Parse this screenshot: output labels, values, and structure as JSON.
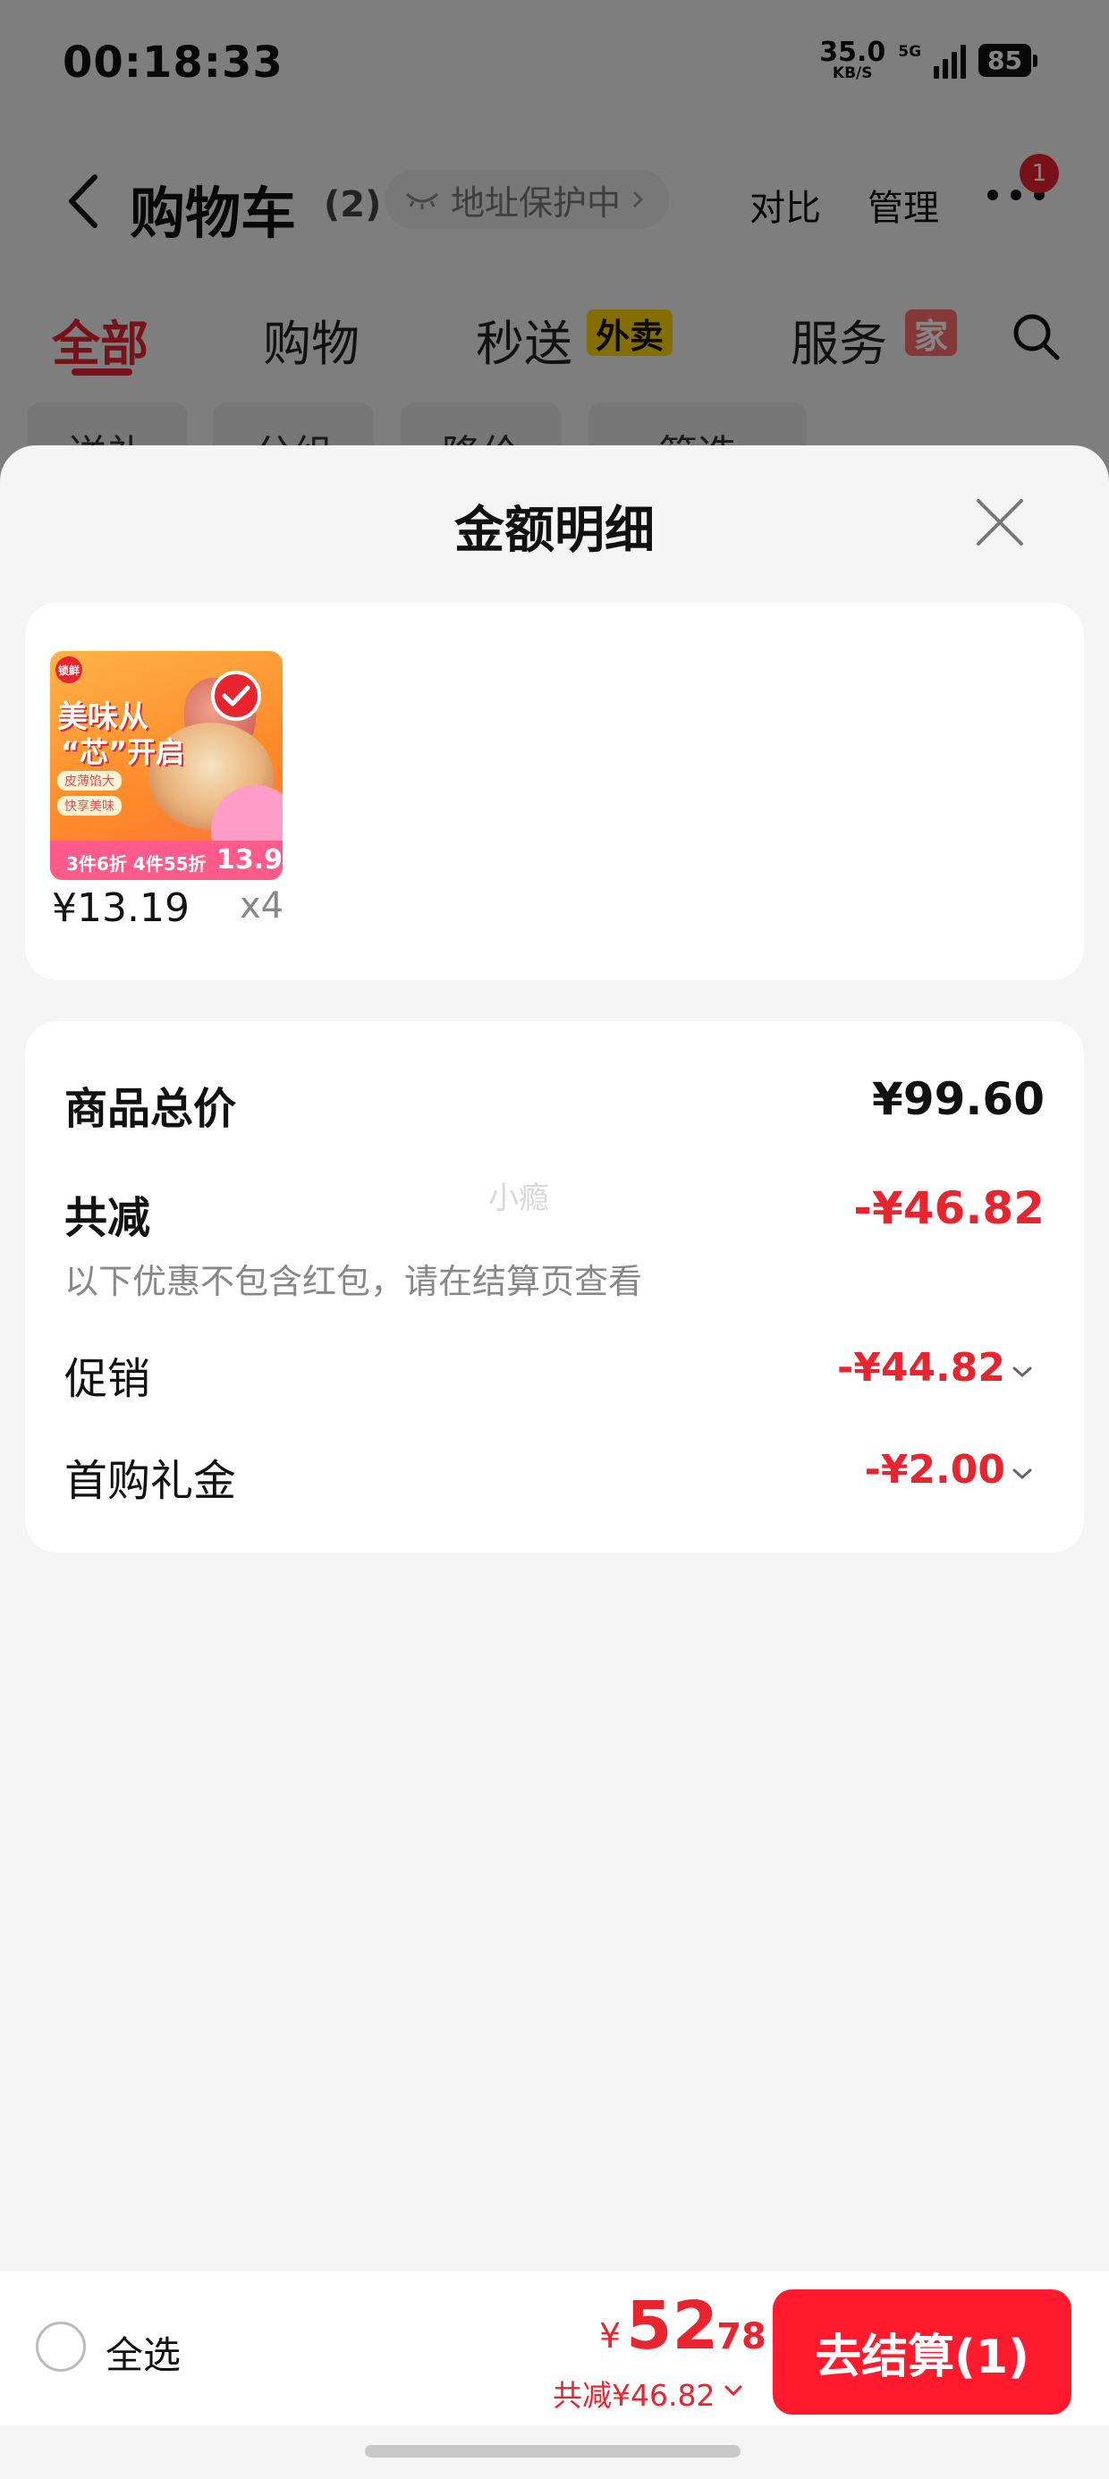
{
  "status": {
    "time": "00:18:33",
    "net_speed_value": "35.0",
    "net_speed_unit": "KB/S",
    "network": "5G",
    "battery": "85"
  },
  "header": {
    "title": "购物车",
    "count": "(2)",
    "address_badge": "地址保护中",
    "compare": "对比",
    "manage": "管理",
    "more_badge": "1"
  },
  "tabs": [
    {
      "label": "全部",
      "active": true
    },
    {
      "label": "购物"
    },
    {
      "label": "秒送",
      "tag": "外卖"
    },
    {
      "label": "服务",
      "tag": "家"
    }
  ],
  "chips": [
    "送礼",
    "分组",
    "降价",
    "筛选"
  ],
  "sheet": {
    "title": "金额明细",
    "item": {
      "image_text": {
        "logo": "锁鲜",
        "slogan_line1": "美味从",
        "slogan_line2": "“芯”开启",
        "feature1": "皮薄馅大",
        "feature2": "快享美味",
        "promo": "3件6折 4件55折",
        "price_tag": "13.9"
      },
      "price": "¥13.19",
      "qty": "x4"
    },
    "total_label": "商品总价",
    "total_value": "¥99.60",
    "discount_label": "共减",
    "discount_value": "-¥46.82",
    "discount_note": "以下优惠不包含红包，请在结算页查看",
    "watermark": "小瘾",
    "promos": [
      {
        "label": "促销",
        "value": "-¥44.82"
      },
      {
        "label": "首购礼金",
        "value": "-¥2.00"
      }
    ]
  },
  "bottom": {
    "select_all": "全选",
    "currency": "¥",
    "total_int": "52",
    "total_dec": ".78",
    "saving": "共减¥46.82",
    "checkout": "去结算(1)"
  },
  "colors": {
    "accent_red": "#e8242e",
    "checkout_red": "#ff1b2d"
  }
}
